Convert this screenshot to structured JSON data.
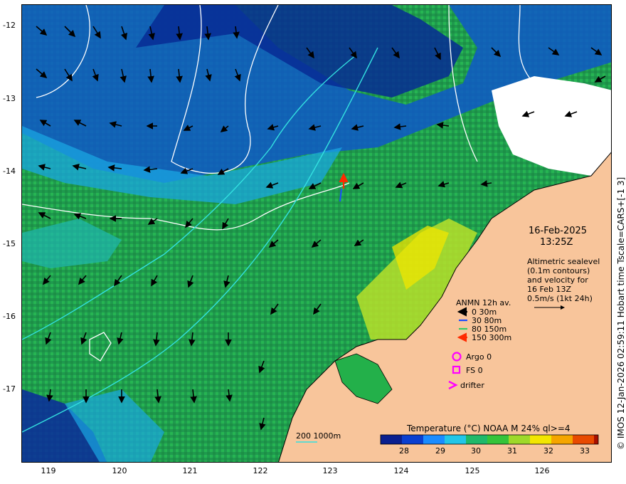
{
  "map": {
    "date": "16-Feb-2025",
    "time": "13:25Z",
    "altimetry_note": [
      "Altimetric sealevel",
      "(0.1m contours)",
      "and velocity for",
      "16 Feb 13Z",
      "0.5m/s (1kt 24h)"
    ],
    "y_ticks": [
      "-12",
      "-13",
      "-14",
      "-15",
      "-16",
      "-17"
    ],
    "x_ticks": [
      "119",
      "120",
      "121",
      "122",
      "123",
      "124",
      "125",
      "126"
    ],
    "credit": "© IMOS 12-Jan-2026 02:59:11 Hobart time Tscale=CARS+[-1 3]",
    "bathymetry_label": "200  1000m"
  },
  "legend": {
    "anmn_title": "ANMN 12h av.",
    "depths": [
      {
        "label": "0 30m",
        "color": "#000000"
      },
      {
        "label": "30 80m",
        "color": "#1a4dff"
      },
      {
        "label": "80 150m",
        "color": "#33cc66"
      },
      {
        "label": "150 300m",
        "color": "#ff2a00"
      }
    ],
    "argo": "Argo 0",
    "fs": "FS 0",
    "drifter": "drifter",
    "marker_color": "#ff00ff"
  },
  "colorbar": {
    "title": "Temperature (°C) NOAA  M 24% ql>=4",
    "ticks": [
      "28",
      "29",
      "30",
      "31",
      "32",
      "33"
    ],
    "range": [
      27.5,
      33.5
    ]
  },
  "colors": {
    "land": "#f8c59b",
    "shelf_green": "#23b04a",
    "deep_blue": "#0a2a9c",
    "contour": "#ffffff",
    "isobath": "#33e0e0"
  }
}
